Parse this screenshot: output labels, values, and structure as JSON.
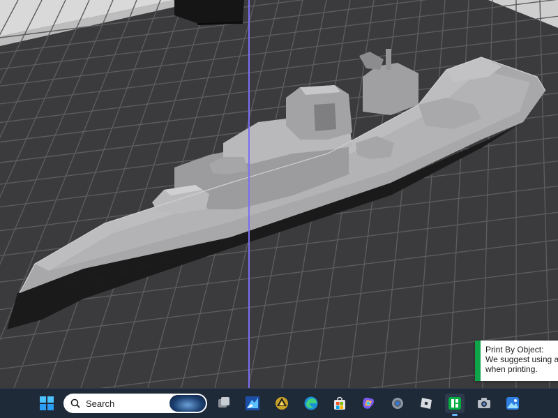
{
  "viewport": {
    "name": "3D build plate view",
    "background": "#3b3b3d",
    "grid_color": "#5a5a5c",
    "axis_line_color": "#7b6ef5",
    "model_color": "#a9a9ab"
  },
  "notification": {
    "title": "Print By Object:",
    "line1": "We suggest using a",
    "line2": "when printing."
  },
  "taskbar": {
    "search_label": "Search",
    "apps": [
      "windows-start-icon",
      "task-view-icon",
      "game-app-icon",
      "slicer-app-icon",
      "edge-browser-icon",
      "microsoft-store-icon",
      "copilot-icon",
      "settings-icon",
      "roblox-icon",
      "bambu-studio-icon",
      "camera-icon",
      "photos-icon"
    ]
  }
}
